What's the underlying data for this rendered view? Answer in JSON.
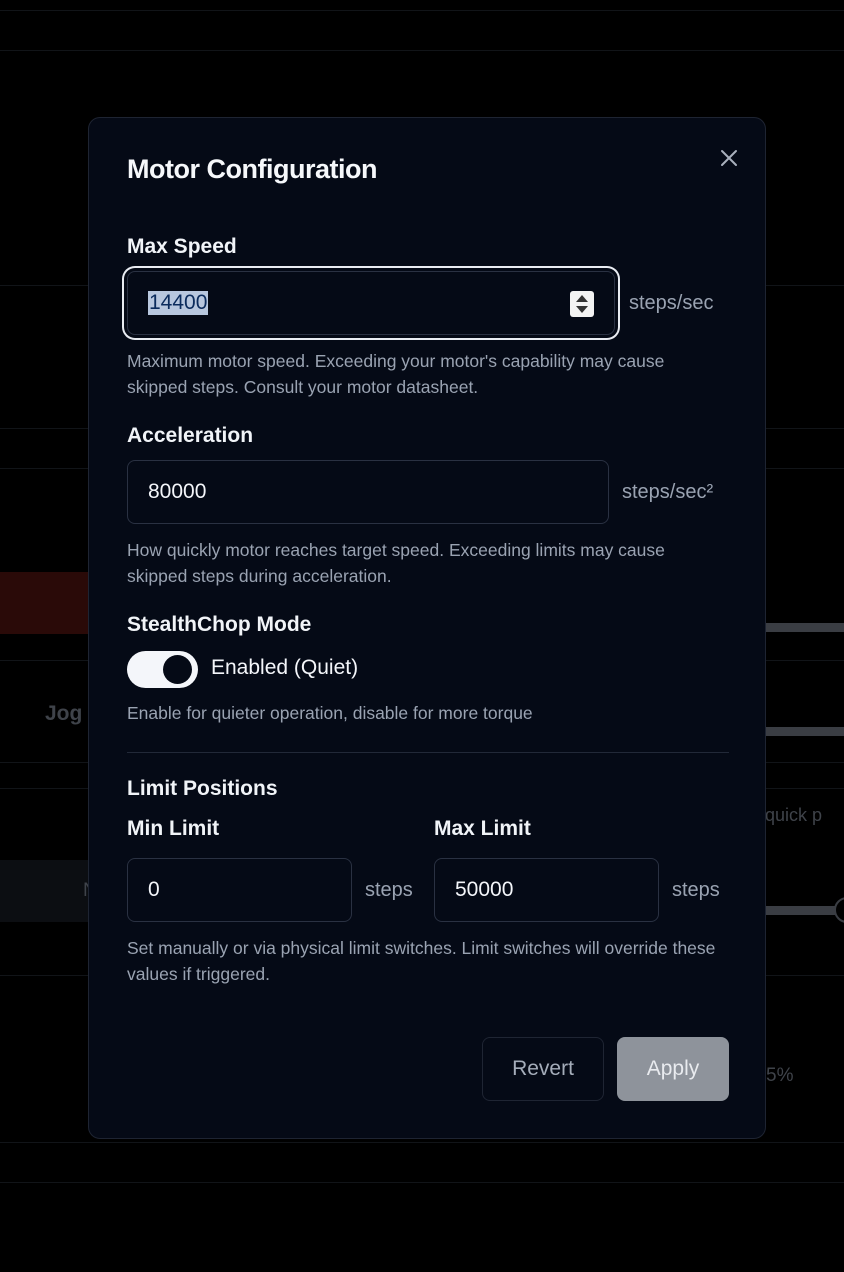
{
  "background": {
    "jog_text": "Jog",
    "quick_text": "e quick p",
    "n_text": "N",
    "percent_text": "5%"
  },
  "modal": {
    "title": "Motor Configuration",
    "close_icon": "close-icon",
    "max_speed": {
      "label": "Max Speed",
      "value": "14400",
      "unit": "steps/sec",
      "help": "Maximum motor speed. Exceeding your motor's capability may cause skipped steps. Consult your motor datasheet."
    },
    "acceleration": {
      "label": "Acceleration",
      "value": "80000",
      "unit": "steps/sec²",
      "help": "How quickly motor reaches target speed. Exceeding limits may cause skipped steps during acceleration."
    },
    "stealthchop": {
      "label": "StealthChop Mode",
      "enabled": true,
      "state_label": "Enabled (Quiet)",
      "help": "Enable for quieter operation, disable for more torque"
    },
    "limits": {
      "heading": "Limit Positions",
      "min_label": "Min Limit",
      "min_value": "0",
      "min_unit": "steps",
      "max_label": "Max Limit",
      "max_value": "50000",
      "max_unit": "steps",
      "help": "Set manually or via physical limit switches. Limit switches will override these values if triggered."
    },
    "buttons": {
      "revert": "Revert",
      "apply": "Apply"
    }
  },
  "colors": {
    "modal_bg": "#050a16",
    "text_primary": "#f1f4f8",
    "text_muted": "#9aa3b2",
    "apply_bg": "#8e939b"
  }
}
